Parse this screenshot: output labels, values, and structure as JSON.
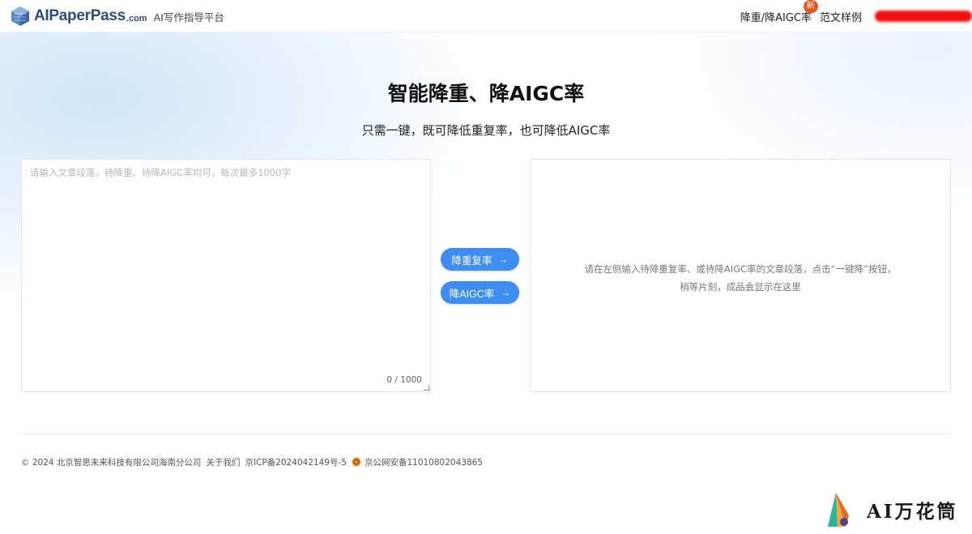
{
  "header": {
    "logo_name": "AIPaperPass",
    "logo_suffix": ".com",
    "tagline": "AI写作指导平台",
    "nav": {
      "reduce_label": "降重/降AIGC率",
      "new_badge": "新",
      "samples_label": "范文样例"
    }
  },
  "hero": {
    "title": "智能降重、降AIGC率",
    "subtitle": "只需一键，既可降低重复率，也可降低AIGC率"
  },
  "input": {
    "placeholder": "请输入文章段落，待降重、待降AIGC率均可，每次最多1000字",
    "value": "",
    "char_count": "0 / 1000"
  },
  "actions": {
    "reduce_repeat": "降重复率",
    "reduce_aigc": "降AIGC率",
    "arrow": "→"
  },
  "output": {
    "hint_line1": "请在左侧输入待降重复率、或待降AIGC率的文章段落，点击“一键降”按钮，",
    "hint_line2": "稍等片刻，成品会显示在这里"
  },
  "footer": {
    "copyright": "© 2024 北京智思未来科技有限公司海南分公司",
    "about": "关于我们",
    "icp": "京ICP备2024042149号-5",
    "police": "京公网安备11010802043865"
  },
  "watermark": {
    "text": "AI万花筒"
  },
  "colors": {
    "accent": "#3d8df2",
    "badge": "#e8541c",
    "logo": "#2f4a7c"
  }
}
